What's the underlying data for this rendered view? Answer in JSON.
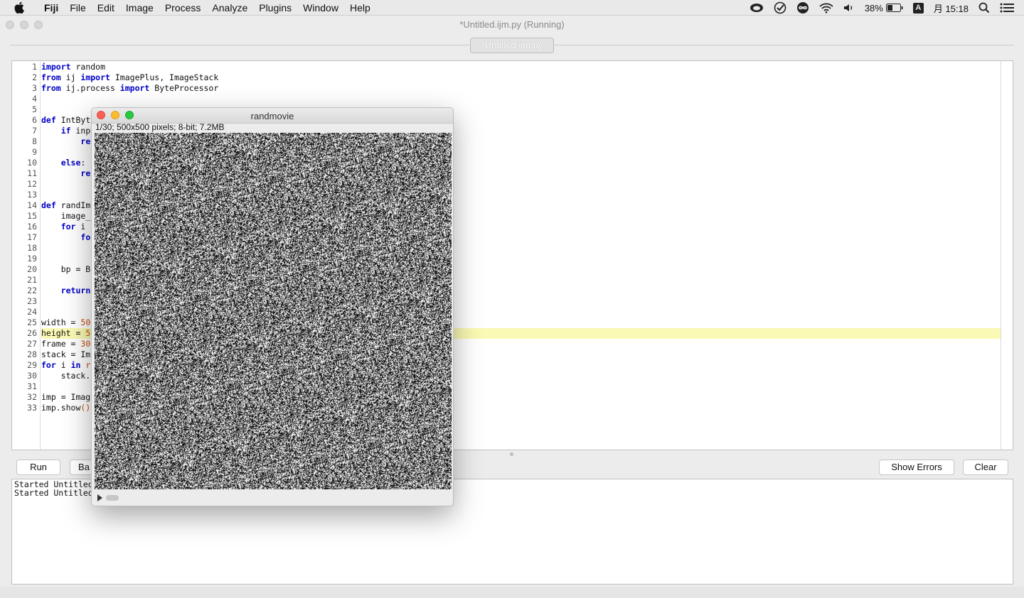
{
  "menubar": {
    "app_name": "Fiji",
    "items": [
      "File",
      "Edit",
      "Image",
      "Process",
      "Analyze",
      "Plugins",
      "Window",
      "Help"
    ],
    "battery": "38%",
    "clock": "月 15:18",
    "input_source": "A"
  },
  "window": {
    "title": "*Untitled.ijm.py (Running)",
    "tab_label": "*Untitled.ijm.py"
  },
  "editor": {
    "line_numbers": [
      "1",
      "2",
      "3",
      "4",
      "5",
      "6",
      "7",
      "8",
      "9",
      "10",
      "11",
      "12",
      "13",
      "14",
      "15",
      "16",
      "17",
      "18",
      "19",
      "20",
      "21",
      "22",
      "23",
      "24",
      "25",
      "26",
      "27",
      "28",
      "29",
      "30",
      "31",
      "32",
      "33"
    ],
    "highlighted_line": 26
  },
  "toolbar": {
    "run_label": "Run",
    "batch_label": "Ba",
    "show_errors_label": "Show Errors",
    "clear_label": "Clear"
  },
  "console": {
    "lines": [
      "Started Untitled",
      "Started Untitled"
    ]
  },
  "image_window": {
    "title": "randmovie",
    "info": "1/30; 500x500 pixels; 8-bit; 7.2MB"
  }
}
